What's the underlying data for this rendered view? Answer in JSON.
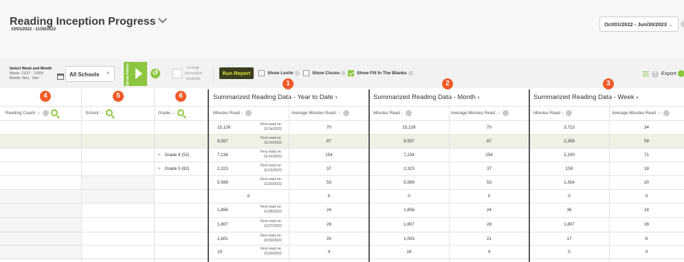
{
  "header": {
    "title": "Reading Inception Progress",
    "subtitle": "10/01/2022 - 11/30/2022",
    "date_range": "Oct/01/2022 - Jun/30/2023"
  },
  "toolbar": {
    "week_label": "Select Week and Month",
    "week_value": "Week: 11/27 - 12/03",
    "month_value": "Month: Nov - Dec",
    "school_select": "All Schools",
    "filters_label": "Show Filters",
    "include_unenrolled": "Include unenrolled students",
    "run_report": "Run Report",
    "show_lexile": "Show Lexile",
    "show_clozes": "Show Clozes",
    "show_fill_blanks": "Show Fill In The Blanks",
    "export": "Export",
    "show_fill_blanks_checked": true
  },
  "badges": [
    "1",
    "2",
    "3",
    "4",
    "5",
    "6"
  ],
  "groups": {
    "ytd": "Summarized Reading Data - Year to Date",
    "month": "Summarized Reading Data - Month",
    "week": "Summarized Reading Data - Week"
  },
  "columns": {
    "reading_coach": "Reading Coach",
    "school": "School",
    "grade": "Grade",
    "minutes_read": "Minutes Read",
    "avg_minutes": "Average Minutes Read"
  },
  "first_read_label": "First read on:",
  "rows": [
    {
      "grade": "",
      "ytd_min": "15,126",
      "first_read": "11/14/2022",
      "ytd_avg": "70",
      "m_min": "15,126",
      "m_avg": "70",
      "w_min": "3,713",
      "w_avg": "34"
    },
    {
      "grade": "",
      "ytd_min": "9,557",
      "first_read": "11/14/2022",
      "ytd_avg": "87",
      "m_min": "9,557",
      "m_avg": "87",
      "w_min": "2,359",
      "w_avg": "59"
    },
    {
      "grade": "Grade 6 (52)",
      "ytd_min": "7,234",
      "first_read": "11/14/2022",
      "ytd_avg": "154",
      "m_min": "7,234",
      "m_avg": "154",
      "w_min": "2,200",
      "w_avg": "71"
    },
    {
      "grade": "Grade 5 (82)",
      "ytd_min": "2,323",
      "first_read": "11/15/2022",
      "ytd_avg": "37",
      "m_min": "2,323",
      "m_avg": "37",
      "w_min": "159",
      "w_avg": "18"
    },
    {
      "grade": "",
      "ytd_min": "5,569",
      "first_read": "11/20/2022",
      "ytd_avg": "53",
      "m_min": "5,569",
      "m_avg": "53",
      "w_min": "1,354",
      "w_avg": "20"
    },
    {
      "grade": "",
      "ytd_min": "0",
      "first_read": "",
      "ytd_avg": "0",
      "m_min": "0",
      "m_avg": "0",
      "w_min": "0",
      "w_avg": "0"
    },
    {
      "grade": "",
      "ytd_min": "1,856",
      "first_read": "11/08/2022",
      "ytd_avg": "24",
      "m_min": "1,856",
      "m_avg": "24",
      "w_min": "36",
      "w_avg": "18"
    },
    {
      "grade": "",
      "ytd_min": "1,807",
      "first_read": "11/27/2022",
      "ytd_avg": "28",
      "m_min": "1,807",
      "m_avg": "28",
      "w_min": "1,807",
      "w_avg": "28"
    },
    {
      "grade": "",
      "ytd_min": "1,601",
      "first_read": "10/30/2022",
      "ytd_avg": "20",
      "m_min": "1,003",
      "m_avg": "21",
      "w_min": "17",
      "w_avg": "6"
    },
    {
      "grade": "",
      "ytd_min": "19",
      "first_read": "11/03/2022",
      "ytd_avg": "4",
      "m_min": "19",
      "m_avg": "4",
      "w_min": "0",
      "w_avg": "0"
    }
  ]
}
